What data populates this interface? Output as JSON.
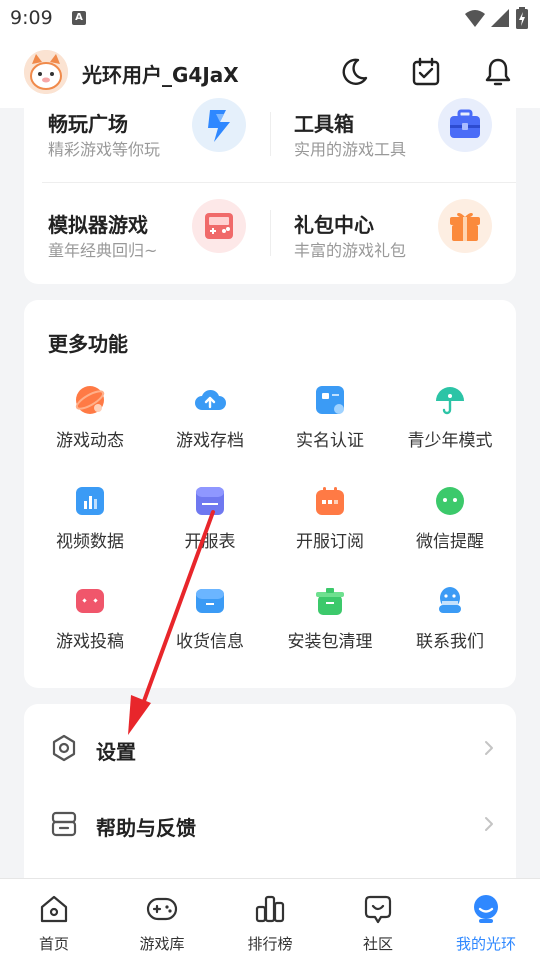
{
  "status_bar": {
    "time": "9:09",
    "notif_icon": "A"
  },
  "header": {
    "username": "光环用户_G4JaX",
    "icons": [
      "moon-icon",
      "calendar-check-icon",
      "bell-icon"
    ]
  },
  "tools": [
    {
      "title": "畅玩广场",
      "subtitle": "精彩游戏等你玩",
      "icon": "lightning-icon",
      "color": "#2f88ff",
      "bg": "#e5f0fb"
    },
    {
      "title": "工具箱",
      "subtitle": "实用的游戏工具",
      "icon": "toolbox-icon",
      "color": "#4a6cf7",
      "bg": "#e8eefc"
    },
    {
      "title": "模拟器游戏",
      "subtitle": "童年经典回归~",
      "icon": "gameboy-icon",
      "color": "#f06a6a",
      "bg": "#fde8e8"
    },
    {
      "title": "礼包中心",
      "subtitle": "丰富的游戏礼包",
      "icon": "gift-icon",
      "color": "#fb8a3c",
      "bg": "#fdeee2"
    }
  ],
  "more": {
    "title": "更多功能",
    "items": [
      {
        "label": "游戏动态",
        "icon": "planet-icon",
        "color": "#ff7a45"
      },
      {
        "label": "游戏存档",
        "icon": "cloud-upload-icon",
        "color": "#3b9bf5"
      },
      {
        "label": "实名认证",
        "icon": "id-card-icon",
        "color": "#3b9bf5"
      },
      {
        "label": "青少年模式",
        "icon": "umbrella-icon",
        "color": "#2cc4a6"
      },
      {
        "label": "视频数据",
        "icon": "bar-chart-icon",
        "color": "#3b9bf5"
      },
      {
        "label": "开服表",
        "icon": "schedule-icon",
        "color": "#6f78f0"
      },
      {
        "label": "开服订阅",
        "icon": "calendar-icon",
        "color": "#ff7a45"
      },
      {
        "label": "微信提醒",
        "icon": "wechat-icon",
        "color": "#3cc96b"
      },
      {
        "label": "游戏投稿",
        "icon": "gamepad-icon",
        "color": "#f0566b"
      },
      {
        "label": "收货信息",
        "icon": "box-icon",
        "color": "#3b9bf5"
      },
      {
        "label": "安装包清理",
        "icon": "trash-icon",
        "color": "#3cc96b"
      },
      {
        "label": "联系我们",
        "icon": "qq-icon",
        "color": "#3b9bf5"
      }
    ]
  },
  "settings_rows": [
    {
      "label": "设置",
      "icon": "settings-icon"
    },
    {
      "label": "帮助与反馈",
      "icon": "help-icon"
    }
  ],
  "tabs": [
    {
      "label": "首页",
      "icon": "home-icon",
      "active": false
    },
    {
      "label": "游戏库",
      "icon": "gamepad-outline-icon",
      "active": false
    },
    {
      "label": "排行榜",
      "icon": "ranking-icon",
      "active": false
    },
    {
      "label": "社区",
      "icon": "community-icon",
      "active": false
    },
    {
      "label": "我的光环",
      "icon": "profile-icon",
      "active": true
    }
  ],
  "accent_color": "#2f88ff",
  "annotation_color": "#e8262b"
}
